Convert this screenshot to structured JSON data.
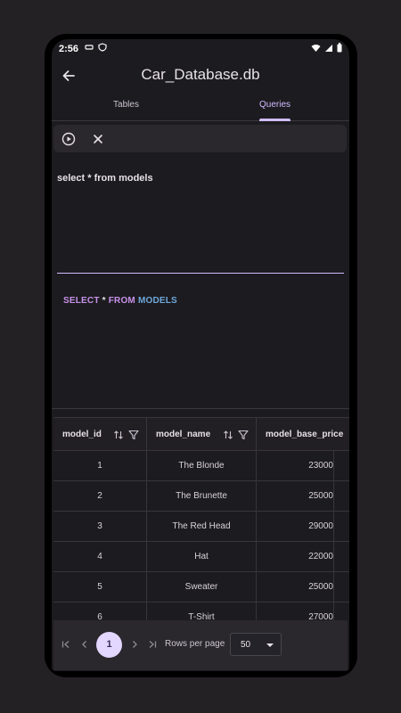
{
  "status_bar": {
    "time": "2:56"
  },
  "app_bar": {
    "title": "Car_Database.db"
  },
  "tabs": [
    {
      "label": "Tables",
      "selected": false
    },
    {
      "label": "Queries",
      "selected": true
    }
  ],
  "editor": {
    "query_text": "select * from models"
  },
  "preview": {
    "kw1": "SELECT",
    "op": "*",
    "kw2": "FROM",
    "table": "MODELS"
  },
  "table": {
    "columns": [
      "model_id",
      "model_name",
      "model_base_price"
    ],
    "rows": [
      [
        "1",
        "The Blonde",
        "23000"
      ],
      [
        "2",
        "The Brunette",
        "25000"
      ],
      [
        "3",
        "The Red Head",
        "29000"
      ],
      [
        "4",
        "Hat",
        "22000"
      ],
      [
        "5",
        "Sweater",
        "25000"
      ],
      [
        "6",
        "T-Shirt",
        "27000"
      ]
    ]
  },
  "pagination": {
    "current_page": "1",
    "rows_per_page_label": "Rows per page",
    "rows_per_page_value": "50"
  },
  "colors": {
    "background": "#1c1b1f",
    "accent": "#d0bcff",
    "keyword": "#c792ea",
    "table_name": "#6fa8dc"
  }
}
